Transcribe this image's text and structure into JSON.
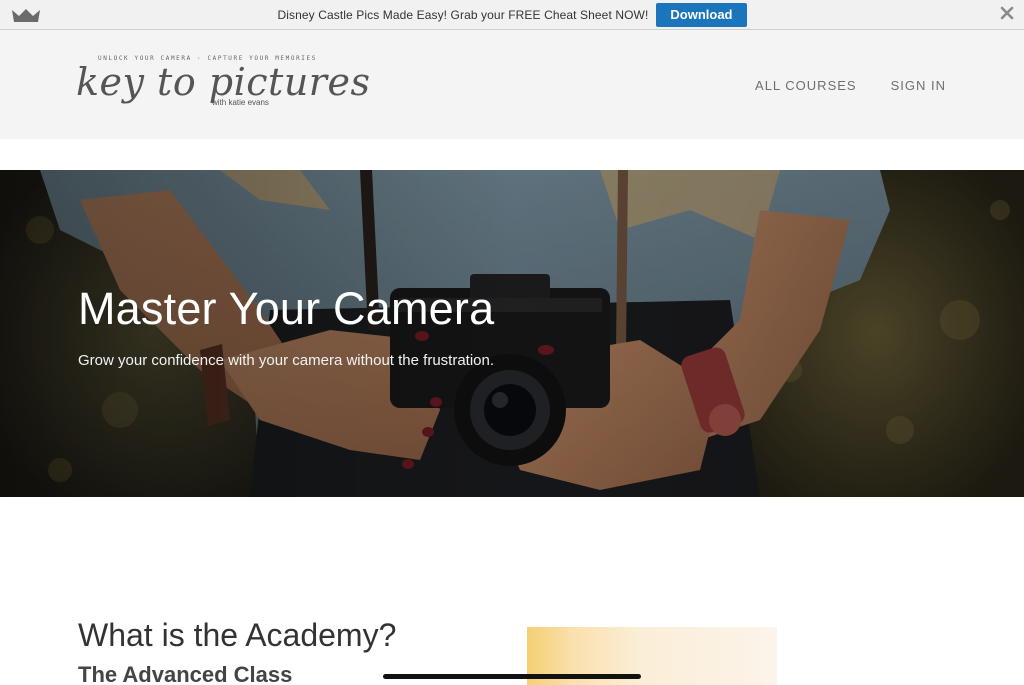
{
  "promo": {
    "text": "Disney Castle Pics Made Easy! Grab your FREE Cheat Sheet NOW!",
    "button_label": "Download",
    "brand_icon": "crown-icon",
    "close_icon": "close-icon"
  },
  "header": {
    "logo": {
      "tagline": "UNLOCK YOUR CAMERA · CAPTURE YOUR MEMORIES",
      "main": "key to pictures",
      "sub": "with katie evans"
    },
    "nav": [
      {
        "label": "ALL COURSES"
      },
      {
        "label": "SIGN IN"
      }
    ]
  },
  "hero": {
    "title": "Master Your Camera",
    "subtitle": "Grow your confidence with your camera without the frustration."
  },
  "academy": {
    "title": "What is the Academy?",
    "subtitle": "The Advanced Class"
  },
  "colors": {
    "promo_button": "#1b75bb",
    "header_bg": "#f4f4f4",
    "promo_bg": "#f1f1f1"
  }
}
